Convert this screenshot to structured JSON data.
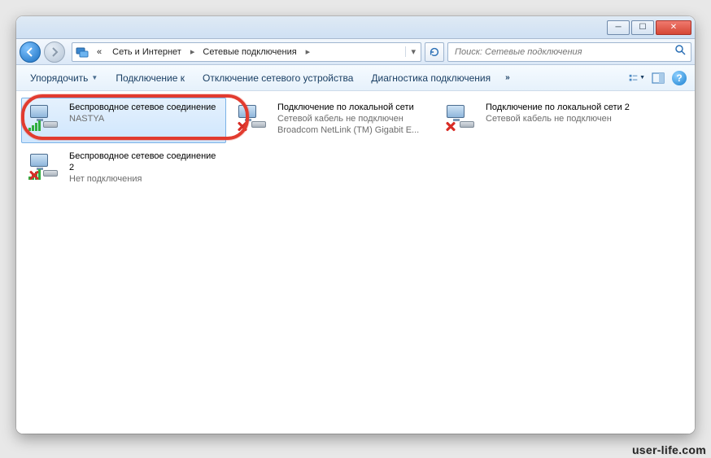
{
  "titlebar": {
    "min": "_",
    "max": "▢",
    "close": "✕"
  },
  "breadcrumb": {
    "prefix": "«",
    "seg1": "Сеть и Интернет",
    "seg2": "Сетевые подключения"
  },
  "search": {
    "placeholder": "Поиск: Сетевые подключения"
  },
  "toolbar": {
    "organize": "Упорядочить",
    "connect": "Подключение к",
    "disable": "Отключение сетевого устройства",
    "diagnose": "Диагностика подключения"
  },
  "connections": [
    {
      "title": "Беспроводное сетевое соединение",
      "sub1": "NASTYA",
      "sub2": "",
      "icon": "wifi",
      "selected": true
    },
    {
      "title": "Подключение по локальной сети",
      "sub1": "Сетевой кабель не подключен",
      "sub2": "Broadcom NetLink (TM) Gigabit E...",
      "icon": "lan-x",
      "selected": false
    },
    {
      "title": "Подключение по локальной сети 2",
      "sub1": "Сетевой кабель не подключен",
      "sub2": "",
      "icon": "lan-x",
      "selected": false
    },
    {
      "title": "Беспроводное сетевое соединение 2",
      "sub1": "Нет подключения",
      "sub2": "",
      "icon": "wifi-x",
      "selected": false
    }
  ],
  "watermark": "user-life.com"
}
